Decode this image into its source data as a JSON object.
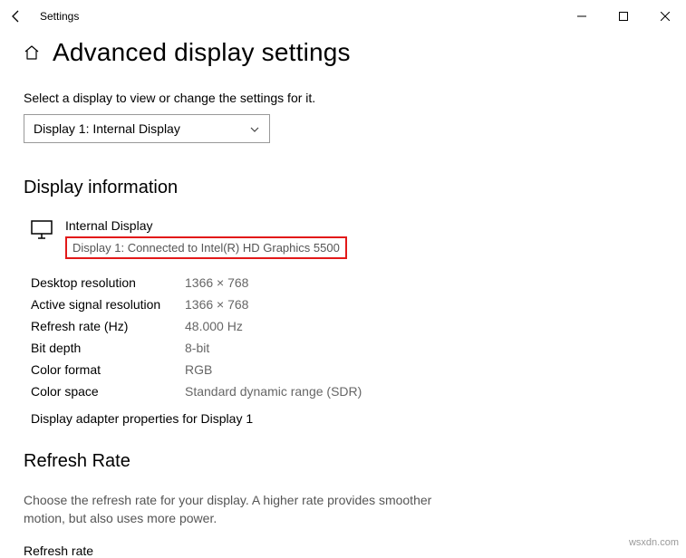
{
  "window": {
    "title": "Settings"
  },
  "page": {
    "title": "Advanced display settings",
    "instruction": "Select a display to view or change the settings for it.",
    "selector_value": "Display 1: Internal Display"
  },
  "display_info": {
    "heading": "Display information",
    "name": "Internal Display",
    "connection": "Display 1: Connected to Intel(R) HD Graphics 5500",
    "rows": [
      {
        "label": "Desktop resolution",
        "value": "1366 × 768"
      },
      {
        "label": "Active signal resolution",
        "value": "1366 × 768"
      },
      {
        "label": "Refresh rate (Hz)",
        "value": "48.000 Hz"
      },
      {
        "label": "Bit depth",
        "value": "8-bit"
      },
      {
        "label": "Color format",
        "value": "RGB"
      },
      {
        "label": "Color space",
        "value": "Standard dynamic range (SDR)"
      }
    ],
    "adapter_link": "Display adapter properties for Display 1"
  },
  "refresh": {
    "heading": "Refresh Rate",
    "description": "Choose the refresh rate for your display. A higher rate provides smoother motion, but also uses more power.",
    "label": "Refresh rate"
  },
  "watermark": "wsxdn.com"
}
